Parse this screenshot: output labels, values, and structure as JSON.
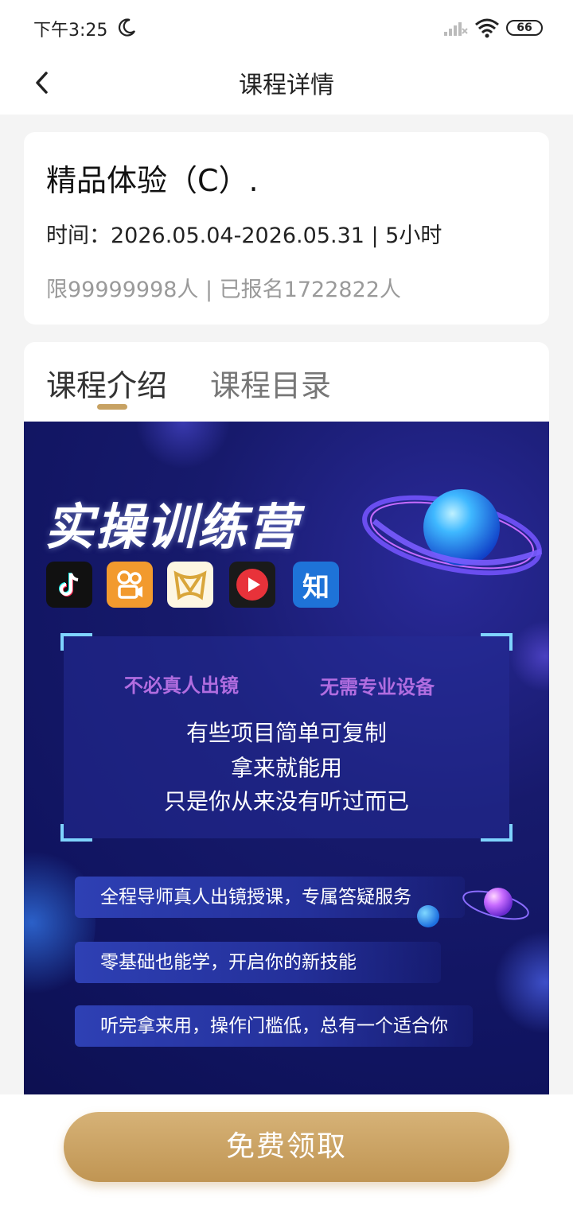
{
  "status_bar": {
    "time": "下午3:25",
    "battery": "66",
    "icons": [
      "moon-icon",
      "signal-icon",
      "wifi-icon",
      "battery-icon"
    ]
  },
  "nav": {
    "back_icon": "chevron-left-icon",
    "title": "课程详情"
  },
  "course": {
    "title": "精品体验（C）.",
    "time": "时间：2026.05.04-2026.05.31 | 5小时",
    "enrollment": "限99999998人 | 已报名1722822人"
  },
  "tabs": [
    {
      "label": "课程介绍",
      "active": true
    },
    {
      "label": "课程目录",
      "active": false
    }
  ],
  "banner": {
    "title": "实操训练营",
    "app_icons": [
      "tiktok-icon",
      "kuaishou-icon",
      "haokan-icon",
      "xigua-icon",
      "zhihu-icon"
    ],
    "zhihu_char": "知",
    "feature_a": "不必真人出镜",
    "feature_b": "无需专业设备",
    "lines": [
      "有些项目简单可复制",
      "拿来就能用",
      "只是你从来没有听过而已"
    ],
    "pills": [
      "全程导师真人出镜授课，专属答疑服务",
      "零基础也能学，开启你的新技能",
      "听完拿来用，操作门槛低，总有一个适合你"
    ]
  },
  "bottom": {
    "claim_label": "免费领取"
  },
  "colors": {
    "accent_gold": "#c7a263",
    "banner_bg": "#101460",
    "feature_purple": "#b16de0"
  }
}
